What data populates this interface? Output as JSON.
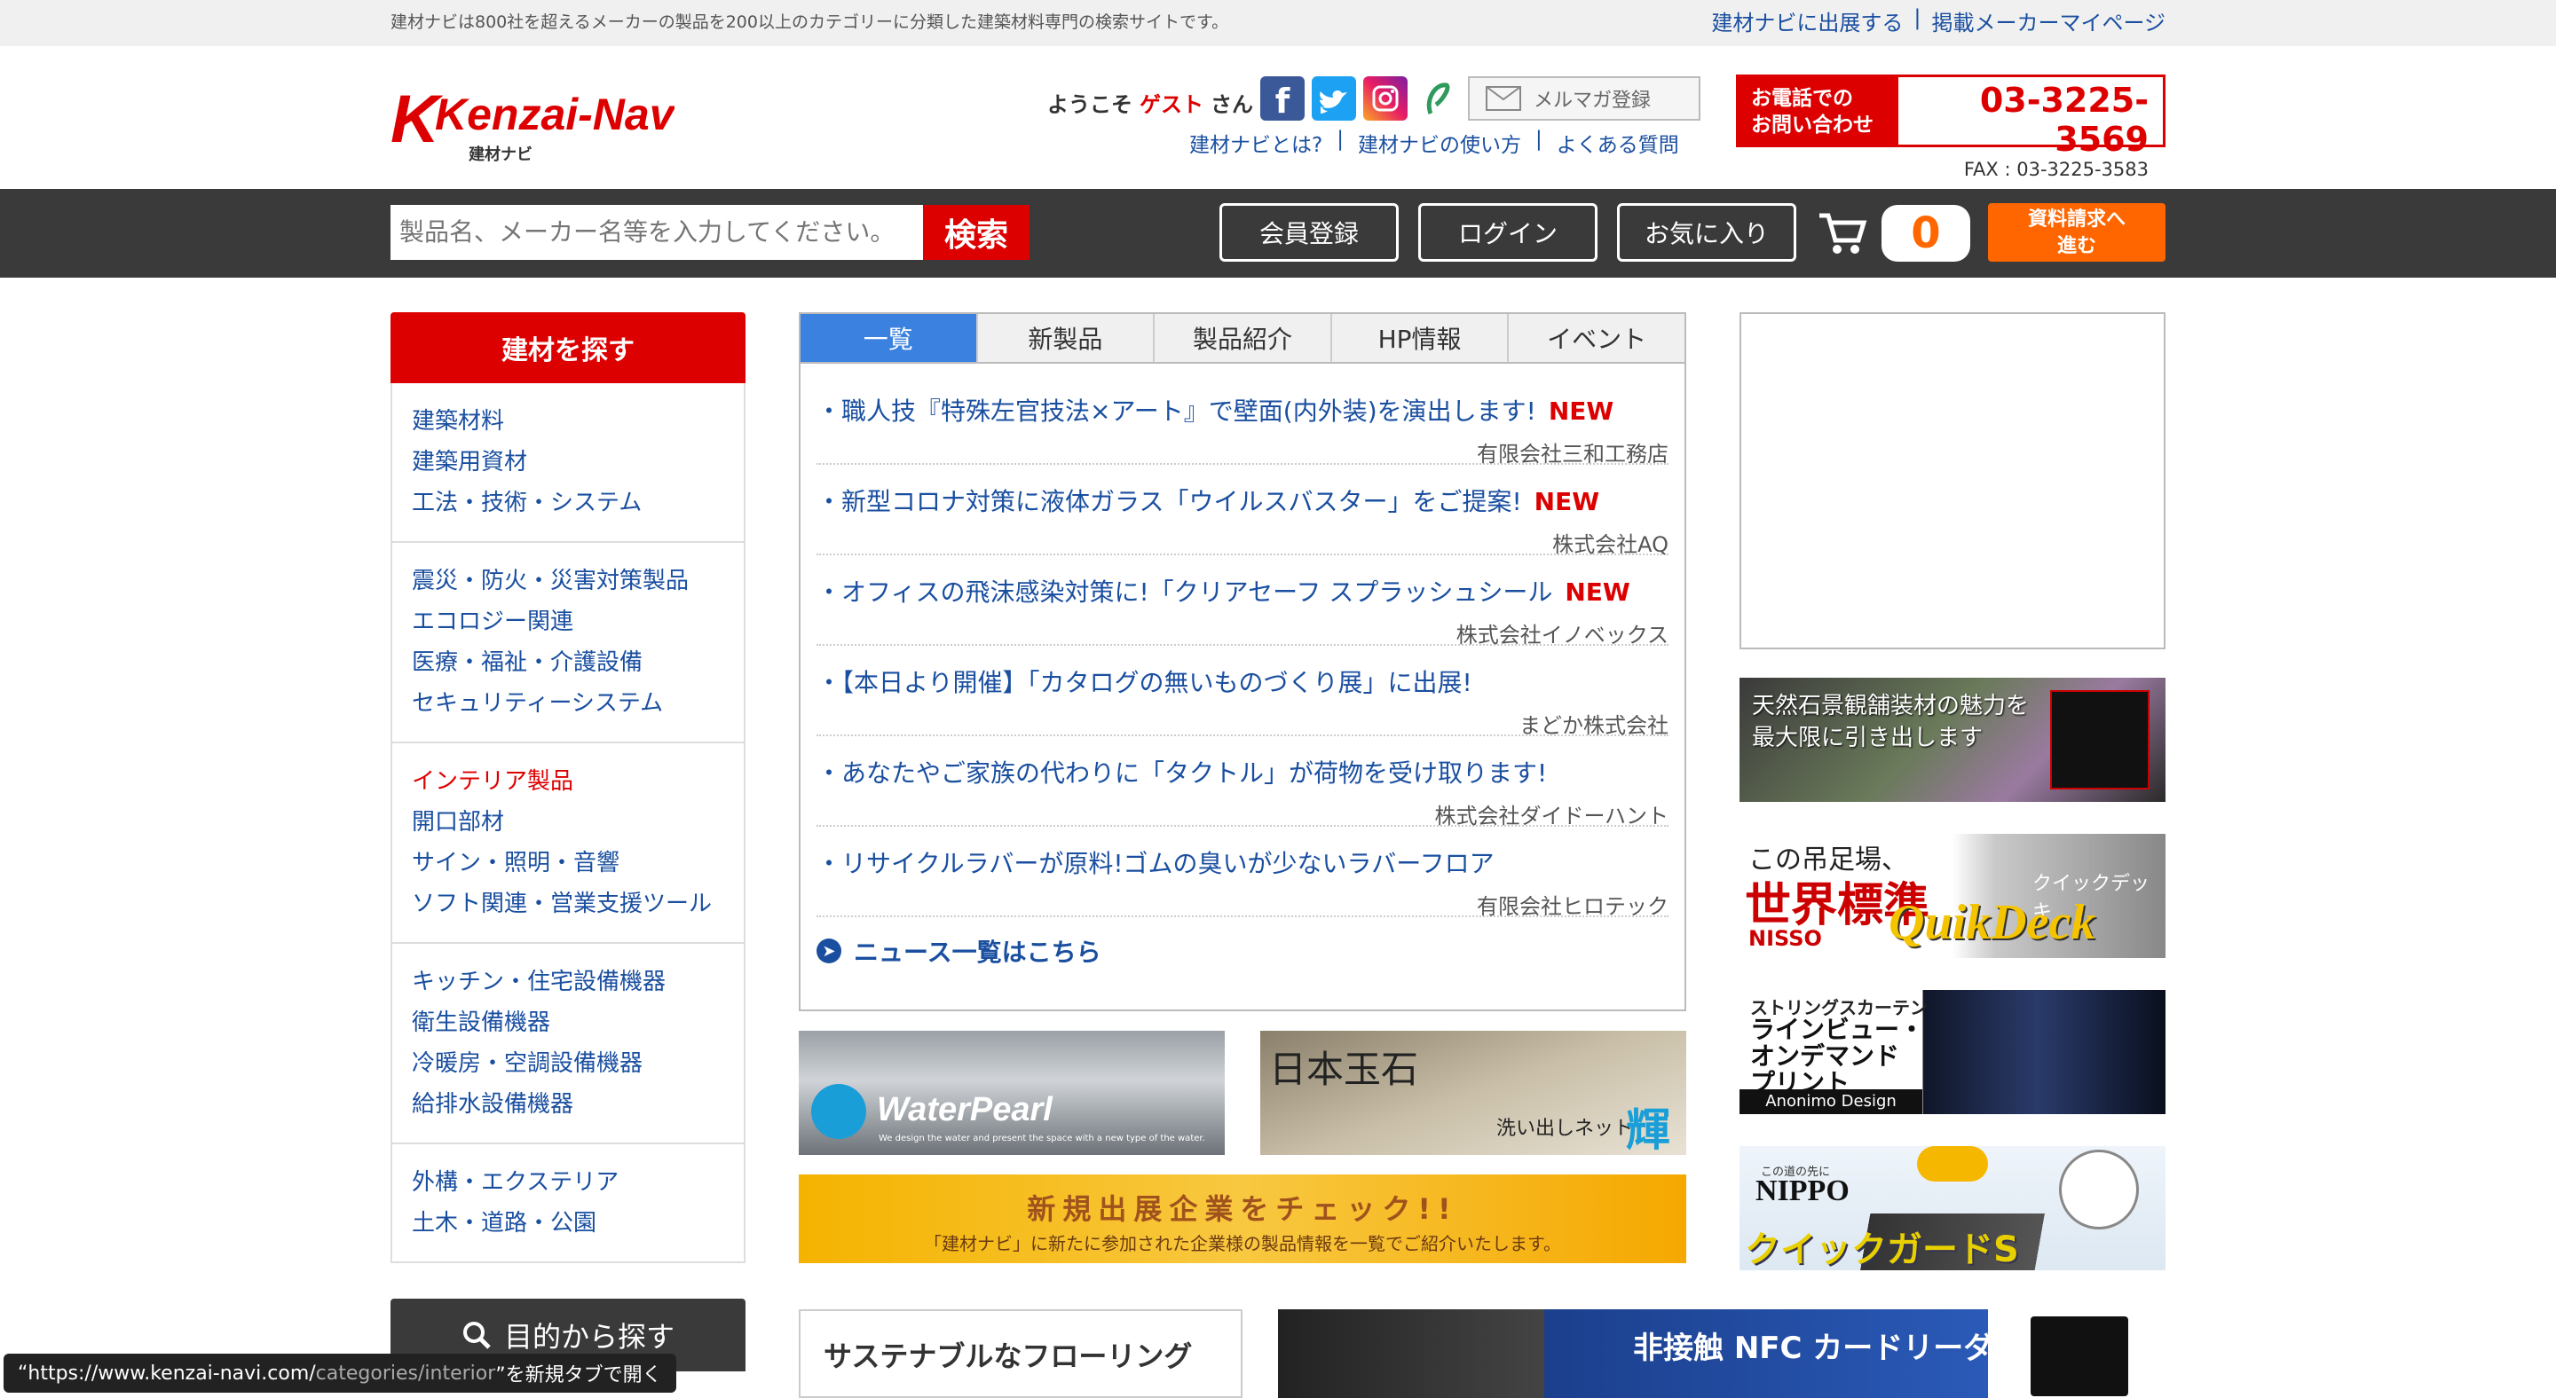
{
  "top": {
    "tagline": "建材ナビは800社を超えるメーカーの製品を200以上のカテゴリーに分類した建築材料専門の検索サイトです。",
    "links": [
      "建材ナビに出展する",
      "|",
      "掲載メーカーマイページ"
    ]
  },
  "header": {
    "logo_text": "Kenzai-Navi",
    "logo_sub": "建材ナビ",
    "welcome_pre": "ようこそ",
    "welcome_guest": "ゲスト",
    "welcome_post": "さん",
    "mail_label": "メルマガ登録",
    "help_links": [
      "建材ナビとは?",
      "|",
      "建材ナビの使い方",
      "|",
      "よくある質問"
    ],
    "tel_label_1": "お電話での",
    "tel_label_2": "お問い合わせ",
    "tel_number": "03-3225-3569",
    "fax": "FAX : 03-3225-3583"
  },
  "search": {
    "placeholder": "製品名、メーカー名等を入力してください。",
    "button": "検索",
    "member": "会員登録",
    "login": "ログイン",
    "favorites": "お気に入り",
    "cart_count": "0",
    "request_1": "資料請求へ",
    "request_2": "進む"
  },
  "sidebar": {
    "title": "建材を探す",
    "groups": [
      [
        "建築材料",
        "建築用資材",
        "工法・技術・システム"
      ],
      [
        "震災・防火・災害対策製品",
        "エコロジー関連",
        "医療・福祉・介護設備",
        "セキュリティーシステム"
      ],
      [
        "インテリア製品",
        "開口部材",
        "サイン・照明・音響",
        "ソフト関連・営業支援ツール"
      ],
      [
        "キッチン・住宅設備機器",
        "衛生設備機器",
        "冷暖房・空調設備機器",
        "給排水設備機器"
      ],
      [
        "外構・エクステリア",
        "土木・道路・公園"
      ]
    ],
    "purpose": "目的から探す"
  },
  "news": {
    "tabs": [
      "一覧",
      "新製品",
      "製品紹介",
      "HP情報",
      "イベント"
    ],
    "items": [
      {
        "title": "・職人技『特殊左官技法×アート』で壁面(内外装)を演出します!",
        "new": "NEW",
        "company": "有限会社三和工務店"
      },
      {
        "title": "・新型コロナ対策に液体ガラス「ウイルスバスター」をご提案!",
        "new": "NEW",
        "company": "株式会社AQ"
      },
      {
        "title": "・オフィスの飛沫感染対策に!「クリアセーフ スプラッシュシール",
        "new": "NEW",
        "company": "株式会社イノベックス"
      },
      {
        "title": "・【本日より開催】「カタログの無いものづくり展」に出展!",
        "new": "",
        "company": "まどか株式会社"
      },
      {
        "title": "・あなたやご家族の代わりに「タクトル」が荷物を受け取ります!",
        "new": "",
        "company": "株式会社ダイドーハント"
      },
      {
        "title": "・リサイクルラバーが原料!ゴムの臭いが少ないラバーフロア",
        "new": "",
        "company": "有限会社ヒロテック"
      }
    ],
    "more": "ニュース一覧はこちら"
  },
  "banners": {
    "waterpearl": "WaterPearl",
    "waterpearl_sub": "We design the water and present the space with a new type of the water.",
    "nihon": "日本玉石",
    "nihon_sub": "洗い出しネット",
    "nihon_glyph": "輝",
    "newco_title": "新規出展企業をチェック!!",
    "newco_sub": "「建材ナビ」に新たに参加された企業様の製品情報を一覧でご紹介いたします。",
    "stone_1": "天然石景観舗装材の魅力を",
    "stone_2": "最大限に引き出します",
    "nisso_1": "この吊足場、",
    "nisso_2": "世界標準",
    "nisso_brand": "NISSO",
    "nisso_en": "QuikDeck",
    "nisso_jp": "クイックデッキ",
    "string_1": "ストリングスカーテン",
    "string_2": "ラインビュー・",
    "string_3": "オンデマンド",
    "string_4": "プリント",
    "string_brand": "Anonimo Design",
    "nippo_tag": "この道の先に",
    "nippo": "NIPPO",
    "nippo_prod": "クイックガードS",
    "flooring": "サステナブルなフローリング",
    "nfc": "非接触 NFC カードリーダ"
  },
  "status_prefix": "“https://www.kenzai-navi.com/",
  "status_path": "categories/interior",
  "status_suffix": "”を新規タブで開く"
}
